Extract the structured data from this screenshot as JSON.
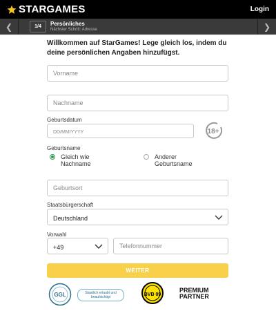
{
  "header": {
    "brand": "STARGAMES",
    "login_label": "Login"
  },
  "stepper": {
    "step_count": "1/4",
    "title": "Persönliches",
    "next": "Nächster Schritt: Adresse"
  },
  "form": {
    "intro": "Willkommen auf StarGames! Lege gleich los, indem du deine persönlichen Angaben hinzufügst.",
    "vorname": {
      "placeholder": "Vorname",
      "value": ""
    },
    "nachname": {
      "placeholder": "Nachname",
      "value": ""
    },
    "geburtsdatum": {
      "label": "Geburtsdatum",
      "placeholder": "DD/MM/YYYY",
      "value": ""
    },
    "age_badge": "18+",
    "geburtsname": {
      "label": "Geburtsname",
      "options": [
        {
          "label": "Gleich wie Nachname",
          "checked": true
        },
        {
          "label": "Anderer Geburtsname",
          "checked": false
        }
      ]
    },
    "geburtsort": {
      "placeholder": "Geburtsort",
      "value": ""
    },
    "staatsbuergerschaft": {
      "label": "Staatsbürgerschaft",
      "value": "Deutschland"
    },
    "vorwahl": {
      "label": "Vorwahl",
      "value": "+49"
    },
    "telefon": {
      "placeholder": "Telefonnummer",
      "value": ""
    },
    "submit_label": "WEITER"
  },
  "footer": {
    "ggl_seal_text": "GGL",
    "ggl_note": "Staatlich erlaubt und beaufsichtigt",
    "bvb_text": "BVB 09",
    "partner_line1": "PREMIUM",
    "partner_line2": "PARTNER"
  },
  "colors": {
    "topbar": "#000000",
    "stepbar": "#3a3a3a",
    "accent_yellow": "#f9d04a",
    "radio_green": "#2e9b4e"
  }
}
